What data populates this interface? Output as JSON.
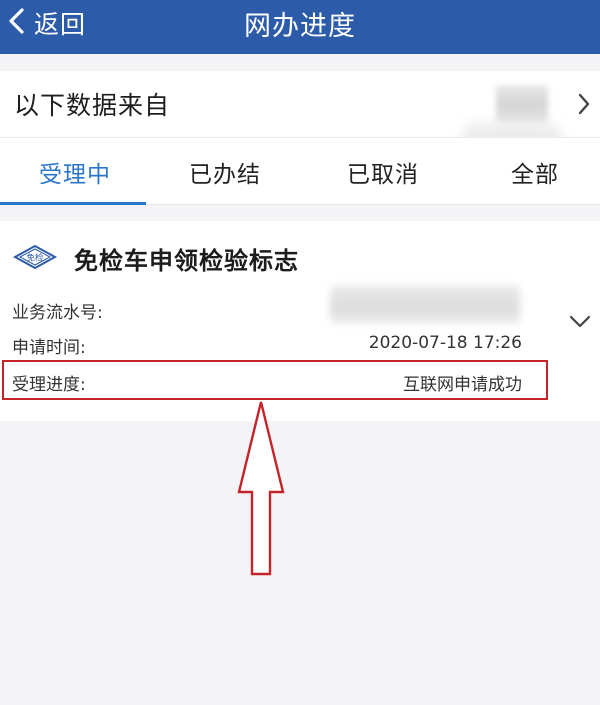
{
  "navbar": {
    "back_label": "返回",
    "title": "网办进度",
    "background_color": "#2c5ba9"
  },
  "source": {
    "label": "以下数据来自"
  },
  "tabs": [
    {
      "label": "受理中",
      "active": true
    },
    {
      "label": "已办结",
      "active": false
    },
    {
      "label": "已取消",
      "active": false
    },
    {
      "label": "全部",
      "active": false
    }
  ],
  "accent_color": "#2c76c9",
  "card": {
    "badge_text": "免检",
    "title": "免检车申领检验标志",
    "fields": [
      {
        "label": "业务流水号:",
        "value": ""
      },
      {
        "label": "申请时间:",
        "value": "2020-07-18 17:26"
      },
      {
        "label": "受理进度:",
        "value": "互联网申请成功"
      }
    ]
  },
  "annotation": {
    "highlight_color": "#c5232a"
  }
}
